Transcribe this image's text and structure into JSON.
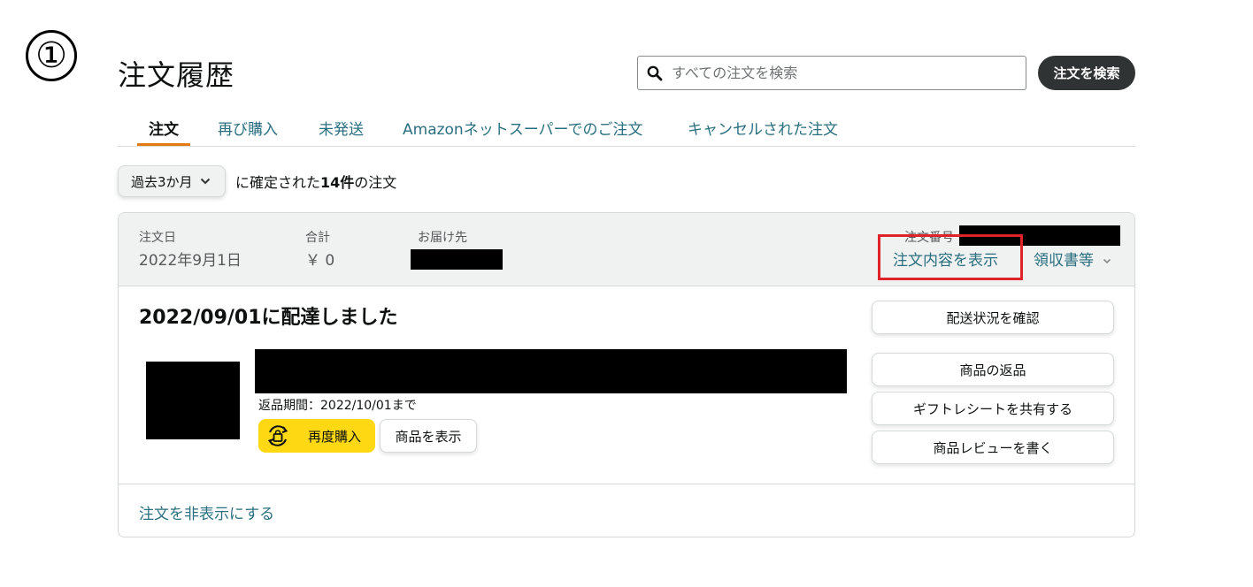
{
  "step_marker": "①",
  "page_title": "注文履歴",
  "search": {
    "placeholder": "すべての注文を検索",
    "button_label": "注文を検索"
  },
  "tabs": [
    {
      "label": "注文",
      "active": true
    },
    {
      "label": "再び購入",
      "active": false
    },
    {
      "label": "未発送",
      "active": false
    },
    {
      "label": "Amazonネットスーパーでのご注文",
      "active": false
    },
    {
      "label": "キャンセルされた注文",
      "active": false
    }
  ],
  "filter": {
    "selected": "過去3か月",
    "text_before": "に確定された",
    "count": "14件",
    "text_after": "の注文"
  },
  "order": {
    "date_label": "注文日",
    "date_value": "2022年9月1日",
    "total_label": "合計",
    "total_value": "￥ 0",
    "ship_to_label": "お届け先",
    "order_number_label": "注文番号",
    "view_details_link": "注文内容を表示",
    "receipt_link": "領収書等",
    "delivery_status": "2022/09/01に配達しました",
    "return_period": "返品期間：2022/10/01まで",
    "buy_again_label": "再度購入",
    "view_item_label": "商品を表示",
    "actions": [
      "配送状況を確認",
      "商品の返品",
      "ギフトレシートを共有する",
      "商品レビューを書く"
    ],
    "hide_order_link": "注文を非表示にする"
  },
  "colors": {
    "link": "#2a6f7f",
    "tab_underline": "#e47911",
    "buy_again_bg": "#ffd814",
    "search_button_bg": "#303333",
    "highlight_box": "#e0232a"
  }
}
